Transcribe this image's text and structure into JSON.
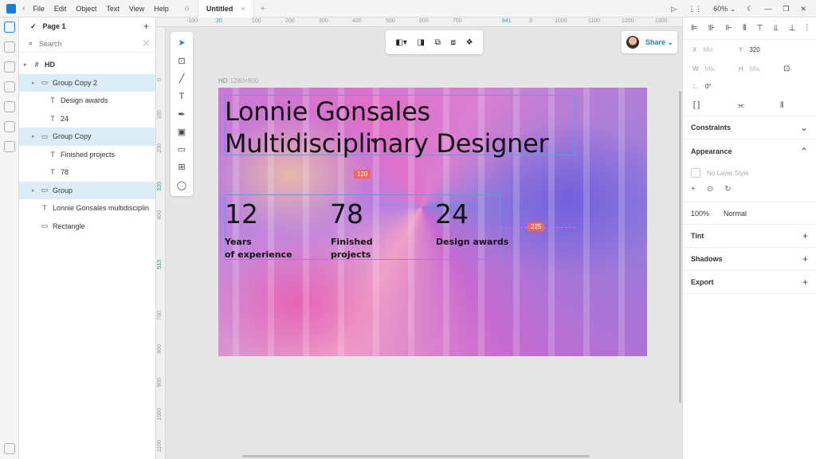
{
  "titlebar": {
    "menu": [
      "File",
      "Edit",
      "Object",
      "Text",
      "View",
      "Help"
    ],
    "tab_title": "Untitled",
    "tab_close": "×",
    "new_tab": "+",
    "zoom": "60%"
  },
  "layers": {
    "page_name": "Page 1",
    "search_placeholder": "Search",
    "items": [
      {
        "label": "HD",
        "icon": "frame-icon",
        "indent": 0,
        "selected": false,
        "top": true
      },
      {
        "label": "Group Copy 2",
        "icon": "folder-icon",
        "indent": 1,
        "selected": true
      },
      {
        "label": "Design awards",
        "icon": "text-icon",
        "indent": 2,
        "selected": false
      },
      {
        "label": "24",
        "icon": "text-icon",
        "indent": 2,
        "selected": false
      },
      {
        "label": "Group Copy",
        "icon": "folder-icon",
        "indent": 1,
        "selected": true
      },
      {
        "label": "Finished projects",
        "icon": "text-icon",
        "indent": 2,
        "selected": false
      },
      {
        "label": "78",
        "icon": "text-icon",
        "indent": 2,
        "selected": false
      },
      {
        "label": "Group",
        "icon": "folder-icon",
        "indent": 1,
        "selected": true
      },
      {
        "label": "Lonnie Gonsales multidisciplin",
        "icon": "text-icon",
        "indent": 1,
        "selected": false
      },
      {
        "label": "Rectangle",
        "icon": "rectangle-icon",
        "indent": 1,
        "selected": false
      }
    ]
  },
  "ruler": {
    "top_ticks": [
      "-100",
      "20",
      "100",
      "200",
      "300",
      "400",
      "500",
      "600",
      "700",
      "841",
      "3",
      "1000",
      "1100",
      "1200",
      "1300"
    ],
    "left_ticks": [
      "0",
      "100",
      "200",
      "320",
      "400",
      "513",
      "700",
      "800",
      "900",
      "1000",
      "1100"
    ]
  },
  "canvas": {
    "frame_name": "HD",
    "frame_size": "1280×800",
    "title_line1": "Lonnie Gonsales",
    "title_line2": "Multidisciplinary Designer",
    "stats": [
      {
        "number": "12",
        "label": "Years\nof experience"
      },
      {
        "number": "78",
        "label": "Finished\nprojects"
      },
      {
        "number": "24",
        "label": "Design awards"
      }
    ],
    "measure_vertical": "120",
    "measure_horizontal": "225",
    "share_label": "Share"
  },
  "props": {
    "x_label": "X",
    "x_value": "Mix",
    "y_label": "Y",
    "y_value": "320",
    "w_label": "W",
    "w_value": "Mix",
    "h_label": "H",
    "h_value": "Mix",
    "rotation": "0°",
    "constraints": "Constraints",
    "appearance": "Appearance",
    "layer_style": "No Layer Style",
    "opacity": "100%",
    "blend": "Normal",
    "tint": "Tint",
    "shadows": "Shadows",
    "export": "Export"
  }
}
